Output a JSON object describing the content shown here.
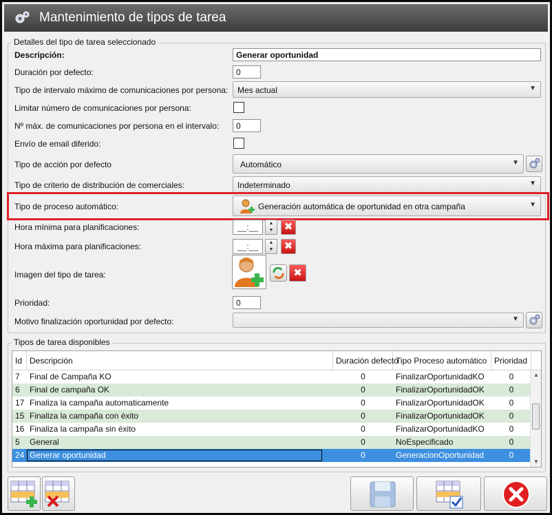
{
  "window": {
    "title": "Mantenimiento de tipos de tarea"
  },
  "details": {
    "legend": "Detalles del tipo de tarea seleccionado",
    "descripcion": {
      "label": "Descripción:",
      "value": "Generar oportunidad"
    },
    "duracion": {
      "label": "Duración por defecto:",
      "value": "0"
    },
    "tipo_intervalo": {
      "label": "Tipo de intervalo máximo de comunicaciones por persona:",
      "value": "Mes actual"
    },
    "limitar": {
      "label": "Limitar número de comunicaciones por persona:",
      "checked": false
    },
    "num_max": {
      "label": "Nº máx. de comunicaciones por persona en el intervalo:",
      "value": "0"
    },
    "envio_email": {
      "label": "Envío de email diferido:",
      "checked": false
    },
    "tipo_accion": {
      "label": "Tipo de acción por defecto",
      "value": "Automático"
    },
    "tipo_criterio": {
      "label": "Tipo de criterio de distribución de comerciales:",
      "value": "Indeterminado"
    },
    "tipo_proceso": {
      "label": "Tipo de proceso automático:",
      "value": "Generación automática de oportunidad en otra campaña"
    },
    "hora_min": {
      "label": "Hora mínima para planificaciones:",
      "value": "__:__"
    },
    "hora_max": {
      "label": "Hora máxima para planificaciones:",
      "value": "__:__"
    },
    "imagen": {
      "label": "Imagen del tipo de tarea:"
    },
    "prioridad": {
      "label": "Prioridad:",
      "value": "0"
    },
    "motivo": {
      "label": "Motivo finalización oportunidad por defecto:",
      "value": ""
    }
  },
  "available": {
    "legend": "Tipos de tarea disponibles",
    "columns": [
      "Id",
      "Descripción",
      "Duración defecto",
      "Tipo Proceso automático",
      "Prioridad"
    ],
    "rows": [
      {
        "id": "7",
        "desc": "Final de Campaña KO",
        "dur": "0",
        "tipo": "FinalizarOportunidadKO",
        "prio": "0"
      },
      {
        "id": "6",
        "desc": "Final de campaña OK",
        "dur": "0",
        "tipo": "FinalizarOportunidadOK",
        "prio": "0"
      },
      {
        "id": "17",
        "desc": "Finaliza la campaña automaticamente",
        "dur": "0",
        "tipo": "FinalizarOportunidadOK",
        "prio": "0"
      },
      {
        "id": "15",
        "desc": "Finaliza la campaña con éxito",
        "dur": "0",
        "tipo": "FinalizarOportunidadOK",
        "prio": "0"
      },
      {
        "id": "16",
        "desc": "Finaliza la campaña sin éxito",
        "dur": "0",
        "tipo": "FinalizarOportunidadKO",
        "prio": "0"
      },
      {
        "id": "5",
        "desc": "General",
        "dur": "0",
        "tipo": "NoEspecificado",
        "prio": "0"
      },
      {
        "id": "24",
        "desc": "Generar oportunidad",
        "dur": "0",
        "tipo": "GeneracionOportunidad",
        "prio": "0"
      }
    ],
    "selected_id": "24"
  },
  "icons": {
    "title": "gears-icon",
    "add_row": "add-row-icon",
    "delete_row": "delete-row-icon",
    "save": "save-icon",
    "accept": "accept-icon",
    "cancel": "cancel-icon"
  },
  "colors": {
    "highlight": "#e0202a",
    "selection": "#3d8fe0",
    "row_alt": "#d9ead9"
  }
}
